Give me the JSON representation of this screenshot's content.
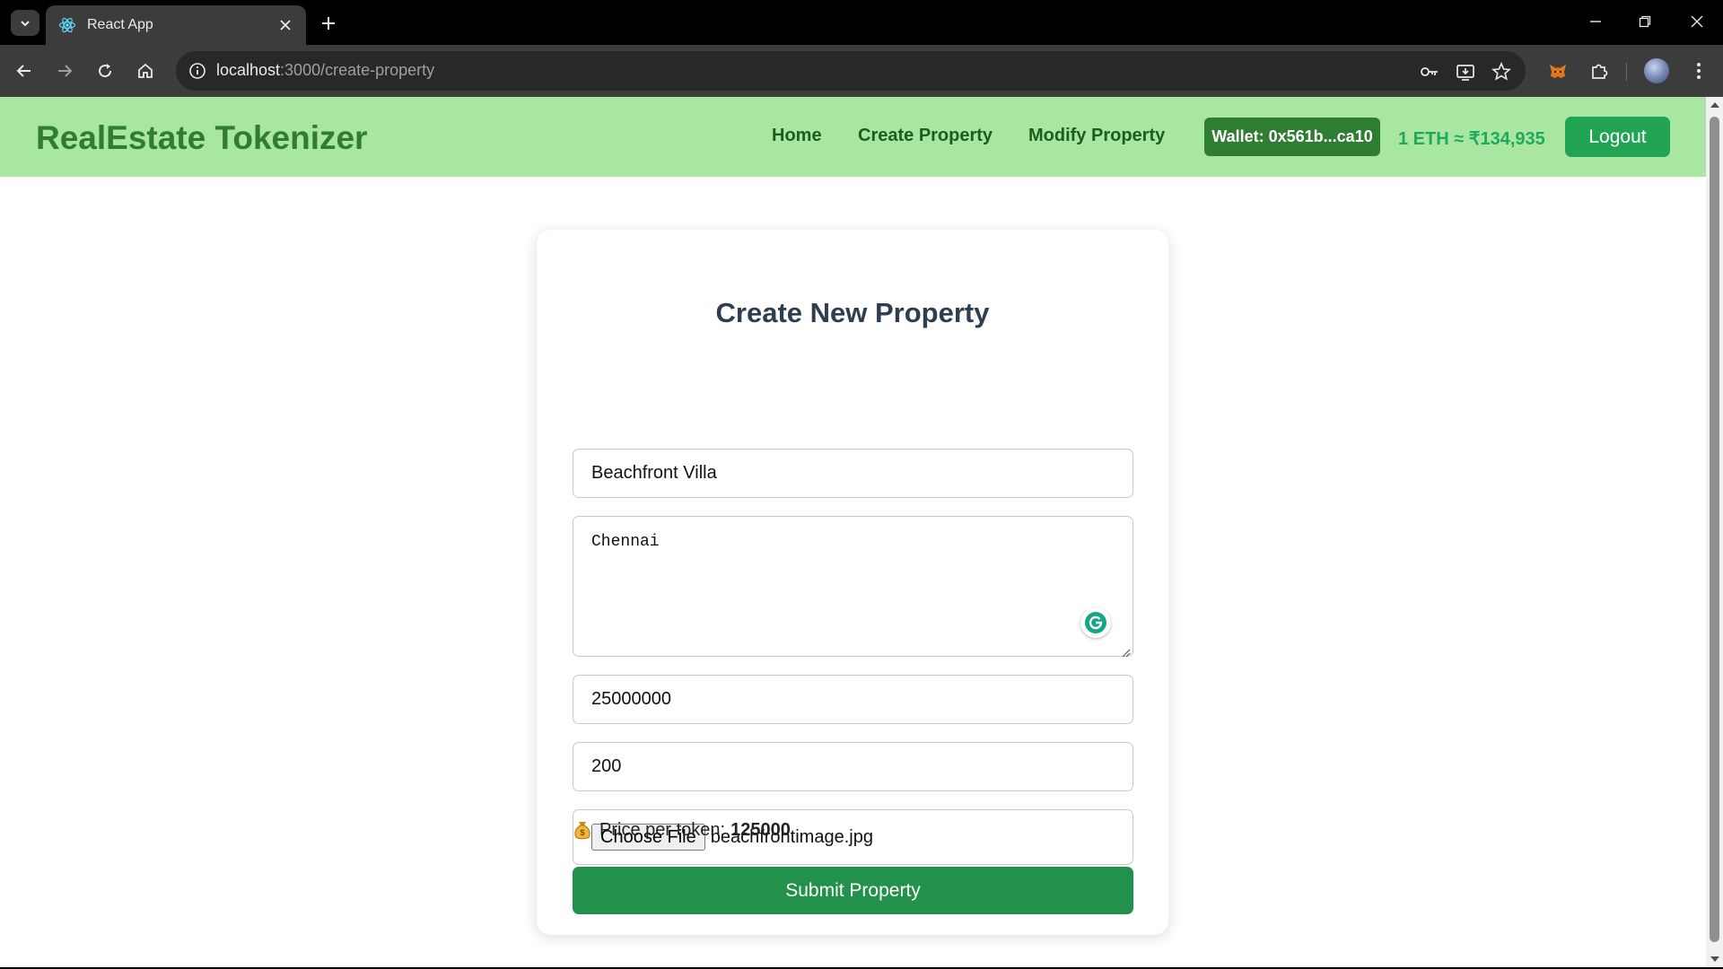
{
  "browser": {
    "tab_title": "React App",
    "url_host": "localhost",
    "url_path": ":3000/create-property"
  },
  "navbar": {
    "brand": "RealEstate Tokenizer",
    "links": [
      "Home",
      "Create Property",
      "Modify Property"
    ],
    "wallet": "Wallet: 0x561b...ca10",
    "eth_rate": "1 ETH ≈ ₹134,935",
    "logout_label": "Logout"
  },
  "form": {
    "title": "Create New Property",
    "name_value": "Beachfront Villa",
    "location_value": "Chennai",
    "price_value": "25000000",
    "tokens_value": "200",
    "file_button_label": "Choose File",
    "file_name": "beachfrontimage.jpg",
    "price_per_token_label": "Price per token:",
    "price_per_token_value": "125000",
    "submit_label": "Submit Property"
  },
  "icons": {
    "favicon": "react-icon",
    "grammarly": "grammarly-icon",
    "money_bag": "money-bag-icon"
  },
  "colors": {
    "navbar_bg": "#a8e6a1",
    "brand": "#2e7d32",
    "wallet_bg": "#2e7d32",
    "eth_rate": "#1eaa5c",
    "logout_bg": "#22a455",
    "submit_bg": "#22914c"
  }
}
